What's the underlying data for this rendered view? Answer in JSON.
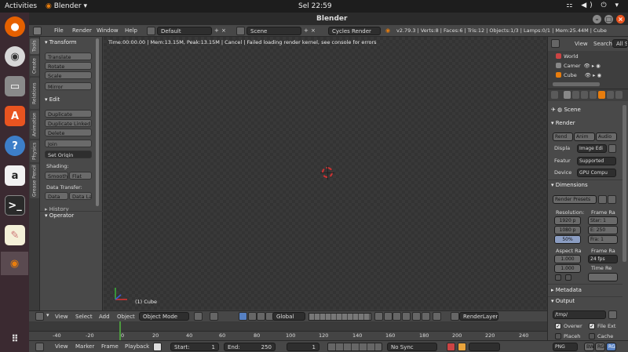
{
  "topbar": {
    "activities": "Activities",
    "app_name": "Blender",
    "clock": "Sel 22:59"
  },
  "window": {
    "title": "Blender"
  },
  "info_header": {
    "menus": [
      "File",
      "Render",
      "Window",
      "Help"
    ],
    "screen_layout": "Default",
    "scene": "Scene",
    "engine": "Cycles Render",
    "stats": "v2.79.3 | Verts:8 | Faces:6 | Tris:12 | Objects:1/3 | Lamps:0/1 | Mem:25.44M | Cube"
  },
  "tool_tabs": [
    "Tools",
    "Create",
    "Relations",
    "Animation",
    "Physics",
    "Grease Pencil"
  ],
  "tool_panel": {
    "transform_header": "Transform",
    "transform_buttons": [
      "Translate",
      "Rotate",
      "Scale"
    ],
    "mirror": "Mirror",
    "edit_header": "Edit",
    "edit_buttons": [
      "Duplicate",
      "Duplicate Linked",
      "Delete"
    ],
    "join": "Join",
    "set_origin": "Set Origin",
    "shading_label": "Shading:",
    "smooth": "Smooth",
    "flat": "Flat",
    "data_transfer_label": "Data Transfer:",
    "data": "Data",
    "data_layout": "Data La",
    "history_header": "History",
    "operator_header": "Operator"
  },
  "viewport": {
    "status": "Time:00:00.00 | Mem:13.15M, Peak:13.15M | Cancel | Failed loading render kernel, see console for errors",
    "object_label": "(1) Cube"
  },
  "viewport_header": {
    "menus": [
      "View",
      "Select",
      "Add",
      "Object"
    ],
    "mode": "Object Mode",
    "orientation": "Global",
    "render_layer": "RenderLayer"
  },
  "timeline": {
    "ticks": [
      "-40",
      "-20",
      "0",
      "20",
      "40",
      "60",
      "80",
      "100",
      "120",
      "140",
      "160",
      "180",
      "200",
      "220",
      "240",
      "260"
    ],
    "current_frame": 1,
    "menus": [
      "View",
      "Marker",
      "Frame",
      "Playback"
    ],
    "start_label": "Start:",
    "start": "1",
    "end_label": "End:",
    "end": "250",
    "frame": "1",
    "sync": "No Sync"
  },
  "outliner": {
    "view": "View",
    "search": "Search",
    "all_scenes": "All Sc",
    "items": [
      "World",
      "Camer",
      "Cube"
    ]
  },
  "properties": {
    "scene_label": "Scene",
    "render_header": "Render",
    "render_buttons": [
      "Rend",
      "Anim",
      "Audio"
    ],
    "display_label": "Displa",
    "display_value": "Image Edi",
    "feature_label": "Featur",
    "feature_value": "Supported",
    "device_label": "Device",
    "device_value": "GPU Compu",
    "dimensions_header": "Dimensions",
    "render_presets": "Render Presets",
    "resolution_label": "Resolution:",
    "res_x": "1920 p",
    "res_y": "1080 p",
    "res_pct": "50%",
    "frame_range_label": "Frame Ra",
    "frame_start": "Star: 1",
    "frame_end": "E: 250",
    "frame_step": "Fra: 1",
    "aspect_label": "Aspect Ra",
    "aspect_x": "1.000",
    "aspect_y": "1.000",
    "frame_rate_label": "Frame Ra",
    "fps": "24 fps",
    "time_remap_label": "Time Re",
    "metadata_header": "Metadata",
    "output_header": "Output",
    "output_path": "/tmp/",
    "overwrite": "Overwr",
    "file_ext": "File Ext",
    "placeholders": "Placeh",
    "cache": "Cache",
    "format": "PNG",
    "bw": "BW",
    "rg": "RG",
    "rgb": "RG"
  },
  "colors": {
    "accent_blue": "#5680c2",
    "orange": "#e87d0d",
    "timeline_cursor": "#4c9a3e"
  }
}
